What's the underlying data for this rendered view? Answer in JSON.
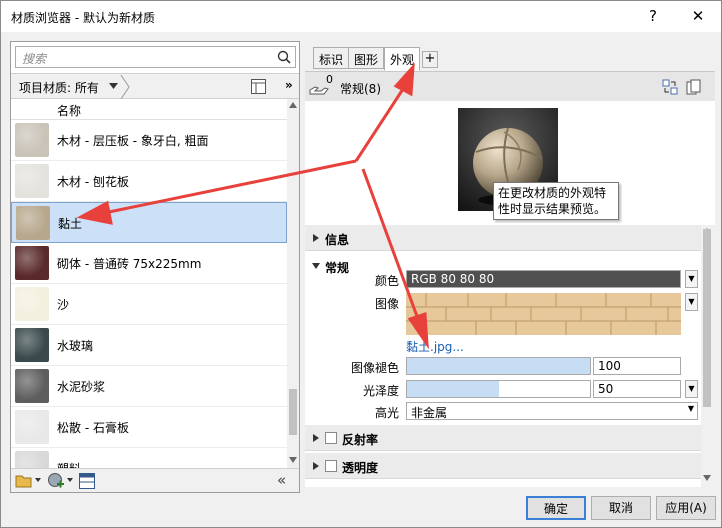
{
  "window": {
    "title": "材质浏览器 - 默认为新材质",
    "help": "?",
    "close": "✕"
  },
  "left": {
    "search_placeholder": "搜索",
    "filter_label": "项目材质: 所有",
    "column_header": "名称",
    "materials": [
      {
        "name": "木材 - 层压板 - 象牙白, 粗面",
        "swatch": "#c9c3b8",
        "selected": false
      },
      {
        "name": "木材 - 刨花板",
        "swatch": "#e4e2dc",
        "selected": false
      },
      {
        "name": "黏土",
        "swatch": "#b7a88d",
        "selected": true
      },
      {
        "name": "砌体 - 普通砖 75x225mm",
        "swatch": "#5a2a2a",
        "selected": false
      },
      {
        "name": "沙",
        "swatch": "#f3f0df",
        "selected": false
      },
      {
        "name": "水玻璃",
        "swatch": "#3a4a4c",
        "selected": false
      },
      {
        "name": "水泥砂浆",
        "swatch": "#5e5e5e",
        "selected": false
      },
      {
        "name": "松散 - 石膏板",
        "swatch": "#e8e8e8",
        "selected": false
      },
      {
        "name": "塑料",
        "swatch": "#d8d8d8",
        "selected": false
      }
    ]
  },
  "right": {
    "tabs": [
      "标识",
      "图形",
      "外观"
    ],
    "active_tab": "外观",
    "add_tab": "+",
    "asset_count_badge": "0",
    "asset_name": "常规(8)",
    "tooltip": "在更改材质的外观特性时显示结果预览。",
    "sections": {
      "info": "信息",
      "general": "常规",
      "reflectivity": "反射率",
      "transparency": "透明度"
    },
    "props": {
      "color_label": "颜色",
      "color_value": "RGB 80 80 80",
      "image_label": "图像",
      "image_file": "黏土.jpg...",
      "fade_label": "图像褪色",
      "fade_value": "100",
      "fade_fraction": 1.0,
      "gloss_label": "光泽度",
      "gloss_value": "50",
      "gloss_fraction": 0.5,
      "highlight_label": "高光",
      "highlight_value": "非金属"
    }
  },
  "buttons": {
    "ok": "确定",
    "cancel": "取消",
    "apply": "应用(A)"
  },
  "colors": {
    "annotation_arrow": "#e8413c",
    "selection": "#cce0f7",
    "link": "#1a5fb4"
  }
}
